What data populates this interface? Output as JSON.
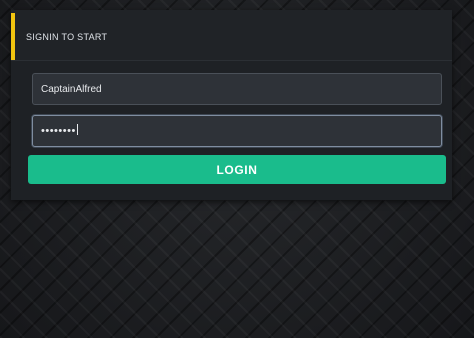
{
  "panel": {
    "title": "SIGNIN TO START"
  },
  "form": {
    "username_value": "CaptainAlfred",
    "password_masked": "••••••••",
    "login_label": "LOGIN"
  },
  "colors": {
    "accent": "#f1c40f",
    "button": "#1abc8c",
    "panel": "#1e2125",
    "field": "#2e3238"
  }
}
